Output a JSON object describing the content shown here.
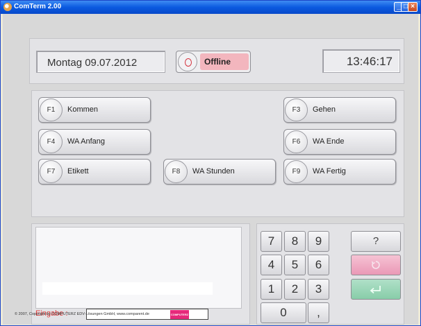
{
  "window": {
    "title": "ComTerm 2.00",
    "minimize_glyph": "_",
    "maximize_glyph": "□",
    "close_glyph": "×"
  },
  "header": {
    "date": "Montag 09.07.2012",
    "status": "Offline",
    "time": "13:46:17"
  },
  "function_buttons": [
    {
      "key": "F1",
      "label": "Kommen"
    },
    {
      "key": "F3",
      "label": "Gehen"
    },
    {
      "key": "F4",
      "label": "WA Anfang"
    },
    {
      "key": "F6",
      "label": "WA Ende"
    },
    {
      "key": "F7",
      "label": "Etikett"
    },
    {
      "key": "F8",
      "label": "WA Stunden"
    },
    {
      "key": "F9",
      "label": "WA Fertig"
    }
  ],
  "input": {
    "label": "Eingabe :",
    "value": ""
  },
  "keypad": {
    "digits": [
      "7",
      "8",
      "9",
      "4",
      "5",
      "6",
      "1",
      "2",
      "3",
      "0",
      ","
    ],
    "help_label": "?",
    "clear_icon": "clear-icon",
    "enter_icon": "enter-icon"
  },
  "footer": {
    "copyright": "© 2007, Copyright by COMPUTERZ EDV-Lösungen GmbH, www.comparent.de",
    "brand": "COMPUTERZ"
  },
  "colors": {
    "offline": "#f3b6be",
    "clear": "#ea98b6",
    "enter": "#88cda9",
    "entry_label": "#e23c3c",
    "titlebar": "#0a5ae0"
  }
}
